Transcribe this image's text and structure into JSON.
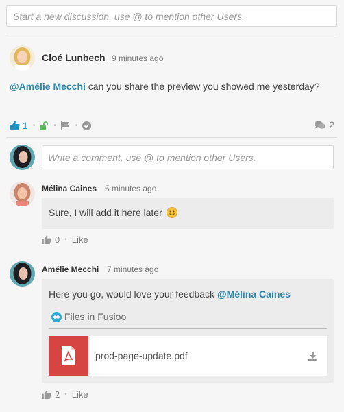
{
  "new_discussion": {
    "placeholder": "Start a new discussion, use @ to mention other Users."
  },
  "post": {
    "author": "Cloé Lunbech",
    "time": "9 minutes ago",
    "mention": "@Amélie Mecchi",
    "text": " can you share the preview you showed me yesterday?",
    "like_count": "1",
    "comment_count": "2",
    "icons": [
      "thumbs-up-icon",
      "unlock-icon",
      "flag-icon",
      "check-circle-icon",
      "comments-icon"
    ],
    "colors": {
      "like": "#1a93c9",
      "unlock": "#5cb85c",
      "mention": "#2e86ab"
    }
  },
  "comment_input": {
    "placeholder": "Write a comment, use @ to mention other Users."
  },
  "comments": [
    {
      "author": "Mélina Caines",
      "time": "5 minutes ago",
      "text": "Sure, I will add it here later",
      "emoji": "😊",
      "like_count": "0",
      "like_label": "Like"
    },
    {
      "author": "Amélie Mecchi",
      "time": "7 minutes ago",
      "text": "Here you go, would love your feedback ",
      "mention": "@Mélina Caines",
      "files_label": "Files in Fusioo",
      "file_name": "prod-page-update.pdf",
      "like_count": "2",
      "like_label": "Like",
      "colors": {
        "pdf": "#d64541"
      }
    }
  ]
}
